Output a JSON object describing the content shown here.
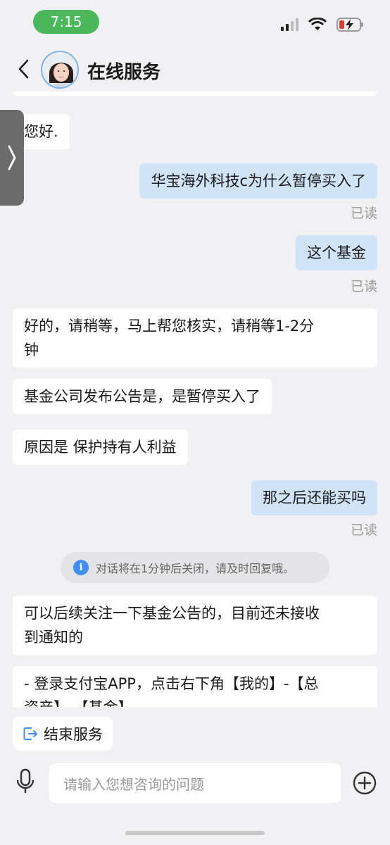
{
  "status_bar": {
    "time": "7:15"
  },
  "header": {
    "title": "在线服务"
  },
  "messages": [
    {
      "side": "left",
      "text": "您好."
    },
    {
      "side": "right",
      "text": "华宝海外科技c为什么暂停买入了",
      "read": "已读"
    },
    {
      "side": "right",
      "text": "这个基金",
      "read": "已读"
    },
    {
      "side": "left",
      "line1": "好的，请稍等，马上帮您核实，请稍等1-2分",
      "line2": "钟"
    },
    {
      "side": "left",
      "text": "基金公司发布公告是，是暂停买入了"
    },
    {
      "side": "left",
      "text": "原因是 保护持有人利益"
    },
    {
      "side": "right",
      "text": "那之后还能买吗",
      "read": "已读"
    },
    {
      "side": "left",
      "line1": "可以后续关注一下基金公告的，目前还未接收",
      "line2": "到通知的"
    },
    {
      "side": "left",
      "line1": "- 登录支付宝APP，点击右下角【我的】-【总",
      "line2": "资产】-【基金】"
    }
  ],
  "notice": {
    "text": "对话将在1分钟后关闭，请及时回复哦。"
  },
  "end_service": {
    "label": "结束服务"
  },
  "input": {
    "placeholder": "请输入您想咨询的问题"
  },
  "colors": {
    "accent": "#3e8ef7",
    "outgoing_bubble": "#cfe3f9",
    "time_pill": "#4cb85c"
  }
}
